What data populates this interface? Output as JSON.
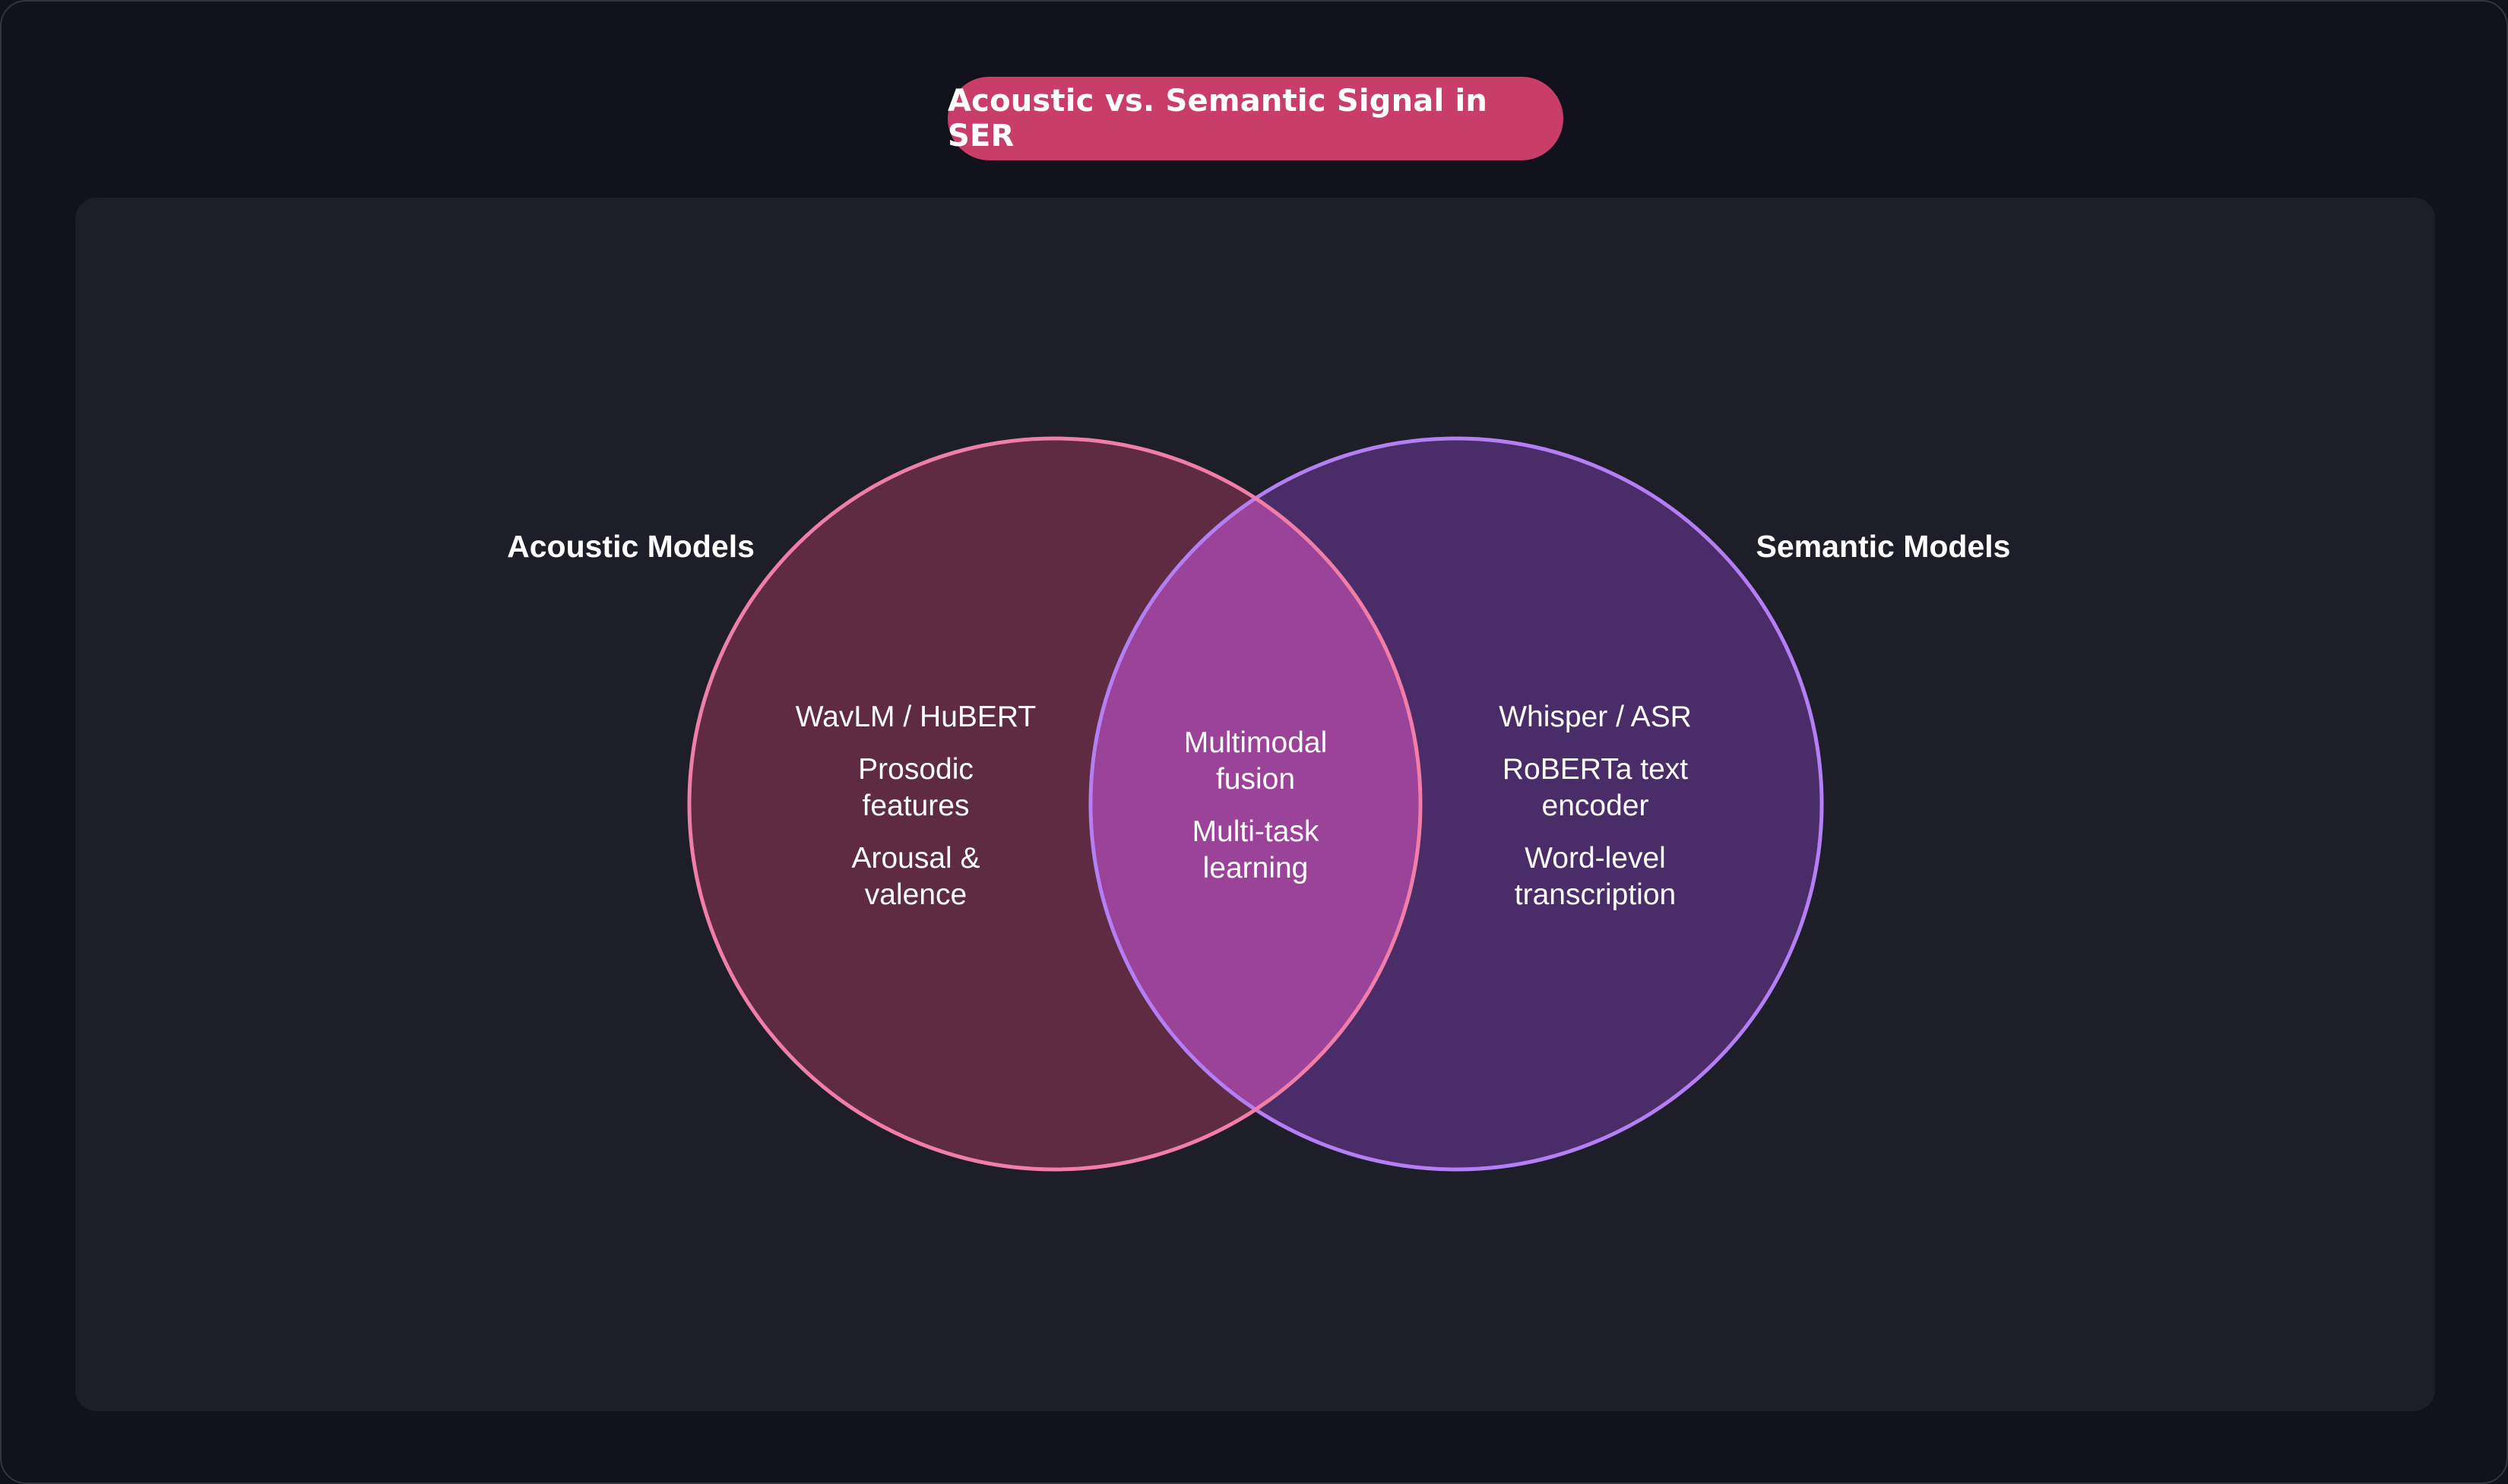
{
  "title": "Acoustic vs. Semantic Signal in SER",
  "sets": {
    "left": {
      "label": "Acoustic Models",
      "color": "#f07ea8",
      "fill": "#5e2b43",
      "items": [
        [
          "WavLM / HuBERT"
        ],
        [
          "Prosodic",
          "features"
        ],
        [
          "Arousal &",
          "valence"
        ]
      ]
    },
    "right": {
      "label": "Semantic Models",
      "color": "#b47ef5",
      "fill": "#4a2d68",
      "items": [
        [
          "Whisper / ASR"
        ],
        [
          "RoBERTa text",
          "encoder"
        ],
        [
          "Word-level",
          "transcription"
        ]
      ]
    },
    "overlap": {
      "fill": "#9b4299",
      "items": [
        [
          "Multimodal",
          "fusion"
        ],
        [
          "Multi-task",
          "learning"
        ]
      ]
    }
  },
  "colors": {
    "background": "#12121c",
    "panel": "#1e1e28",
    "title_pill": "#c93d69"
  }
}
